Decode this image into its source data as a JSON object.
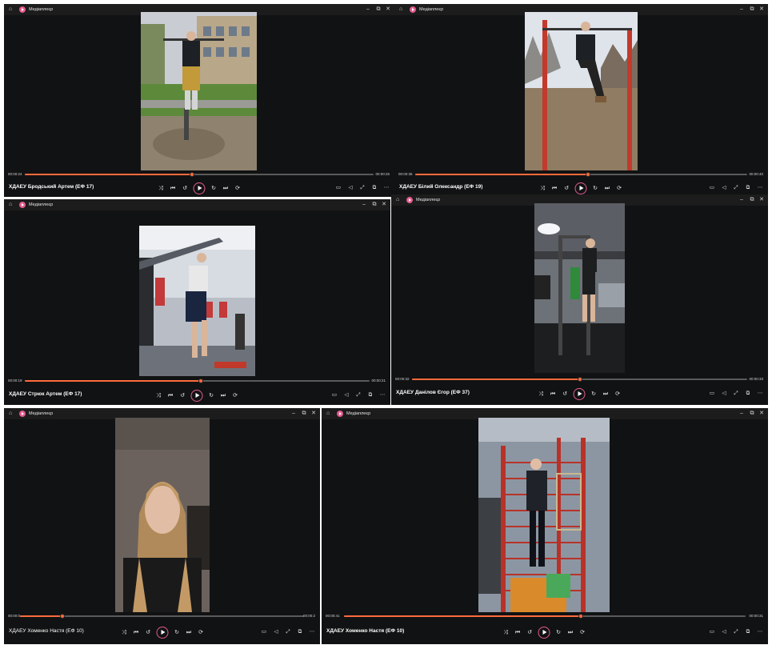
{
  "app": {
    "name": "Медіаплеєр"
  },
  "window_controls": {
    "minimize": "–",
    "maximize": "⧉",
    "close": "✕"
  },
  "icons": {
    "home": "home-icon",
    "app": "media-player-app-icon",
    "shuffle": "shuffle-icon",
    "previous": "previous-icon",
    "back10": "skip-back-10-icon",
    "play": "play-icon",
    "forward30": "skip-forward-30-icon",
    "next": "next-icon",
    "repeat": "repeat-icon",
    "subtitles": "subtitles-icon",
    "volume": "volume-icon",
    "fullscreen": "fullscreen-icon",
    "miniplayer": "miniplayer-icon",
    "more": "more-icon"
  },
  "colors": {
    "accent": "#ff6b3d",
    "play_ring": "#e35b8e",
    "background": "#111213"
  },
  "windows": [
    {
      "title": "ХДАЕУ Бродський Артем (ЕФ 17)",
      "time_current": "00:00:24",
      "time_total": "00:00:25",
      "progress": 0.48
    },
    {
      "title": "ХДАЕУ Білий Олександр (ЕФ 19)",
      "time_current": "00:00:36",
      "time_total": "00:00:40",
      "progress": 0.52
    },
    {
      "title": "ХДАЕУ Стрюк Артем (ЕФ 17)",
      "time_current": "00:00:19",
      "time_total": "00:00:21",
      "progress": 0.51
    },
    {
      "title": "ХДАЕУ Данілов Єгор (ЕФ 37)",
      "time_current": "00:00:32",
      "time_total": "00:00:33",
      "progress": 0.5
    },
    {
      "title": "ХДАЕУ Хоменко Настя (ЕФ 10)",
      "time_current": "00:00:0",
      "time_total": "00:00:2",
      "progress": 0.15
    },
    {
      "title": "ХДАЕУ Хоменко Настя (ЕФ 10)",
      "time_current": "00:00:41",
      "time_total": "00:00:31",
      "progress": 0.59
    }
  ]
}
